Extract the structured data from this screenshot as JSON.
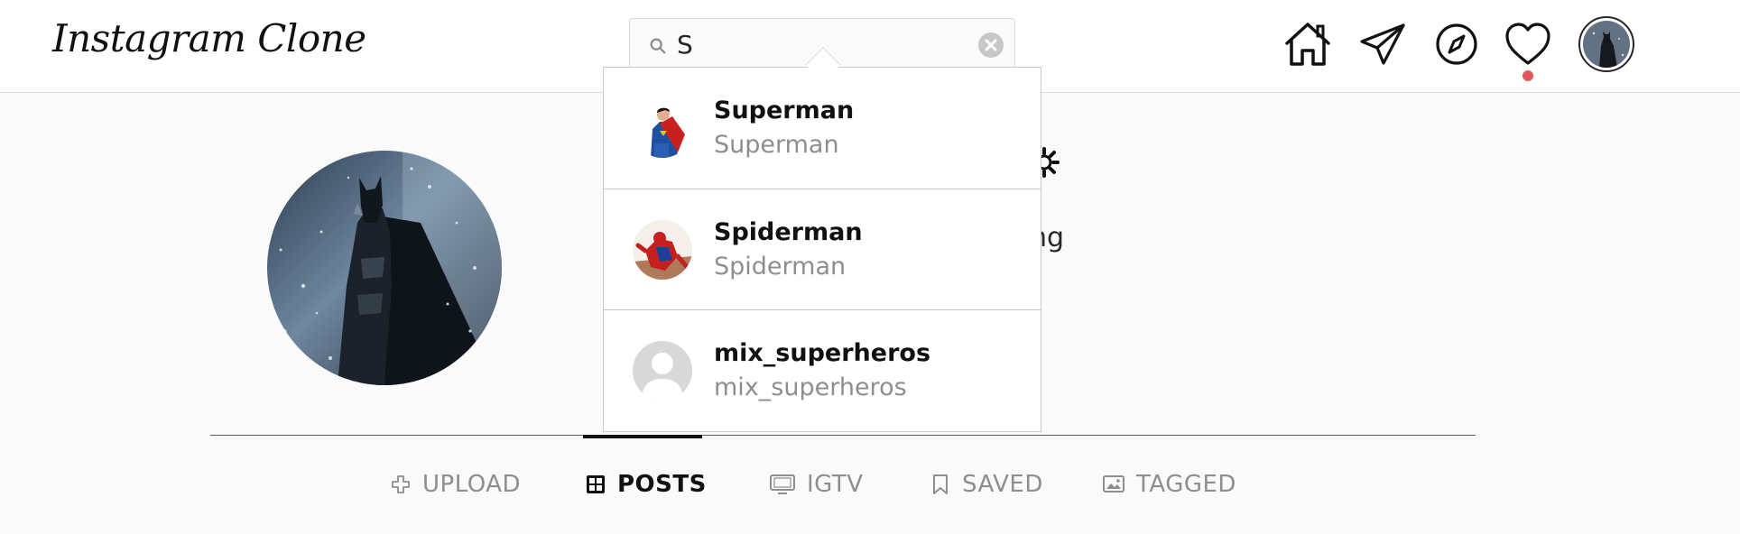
{
  "header": {
    "logo": "Instagram Clone",
    "search": {
      "value": "S",
      "placeholder": "Search"
    },
    "nav_icons": [
      "home-icon",
      "paper-plane-icon",
      "compass-icon",
      "heart-icon",
      "profile-avatar"
    ]
  },
  "profile": {
    "following_fragment": "ng"
  },
  "search_results": [
    {
      "username": "Superman",
      "full_name": "Superman",
      "avatar": "superman-avatar"
    },
    {
      "username": "Spiderman",
      "full_name": "Spiderman",
      "avatar": "spiderman-avatar"
    },
    {
      "username": "mix_superheros",
      "full_name": "mix_superheros",
      "avatar": "default-avatar"
    }
  ],
  "tabs": [
    {
      "label": "UPLOAD",
      "icon": "plus-icon",
      "active": false
    },
    {
      "label": "POSTS",
      "icon": "grid-icon",
      "active": true
    },
    {
      "label": "IGTV",
      "icon": "tv-icon",
      "active": false
    },
    {
      "label": "SAVED",
      "icon": "bookmark-icon",
      "active": false
    },
    {
      "label": "TAGGED",
      "icon": "tagged-photo-icon",
      "active": false
    }
  ],
  "colors": {
    "notification_dot": "#e05a5a",
    "text_primary": "#262626",
    "text_secondary": "#8e8e8e",
    "border": "#dbdbdb"
  }
}
